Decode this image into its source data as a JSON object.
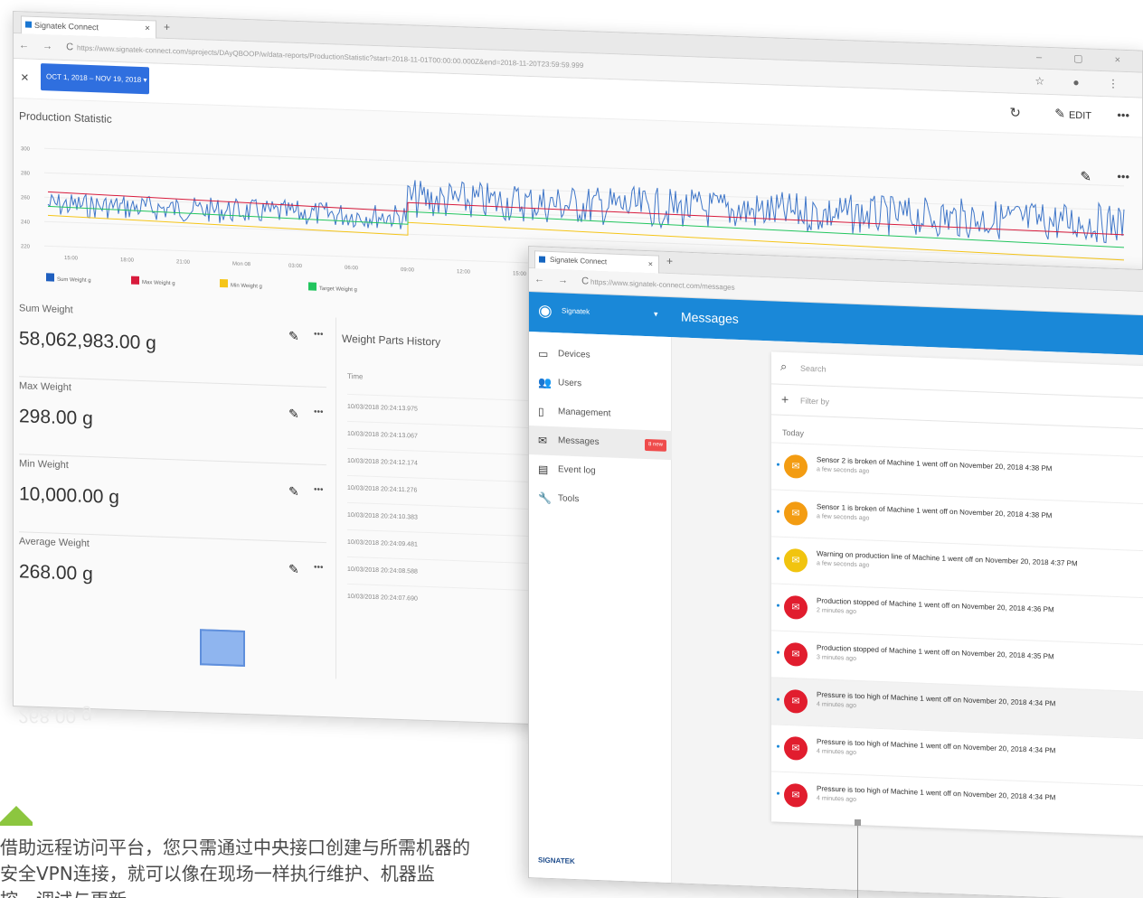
{
  "back_window": {
    "tab_title": "Signatek Connect",
    "url": "https://www.signatek-connect.com/sprojects/DAyQBOOP/w/data-reports/ProductionStatistic?start=2018-11-01T00:00:00.000Z&end=2018-11-20T23:59:59.999",
    "date_range": "OCT 1, 2018 – NOV 19, 2018 ▾",
    "edit_label": "EDIT",
    "chart_title": "Production Statistic",
    "chart_data": {
      "type": "line",
      "y_ticks": [
        "300",
        "280",
        "260",
        "240",
        "220"
      ],
      "x_ticks": [
        "15:00",
        "18:00",
        "21:00",
        "Mon 08",
        "03:00",
        "06:00",
        "09:00",
        "12:00",
        "15:00"
      ],
      "legend": [
        "Sum Weight g",
        "Max Weight g",
        "Min Weight g",
        "Target Weight g"
      ],
      "colors": [
        "#1f5fbf",
        "#d81b3c",
        "#f5c518",
        "#22c55e"
      ]
    },
    "stats": [
      {
        "label": "Sum Weight",
        "value": "58,062,983.00 g"
      },
      {
        "label": "Max Weight",
        "value": "298.00 g"
      },
      {
        "label": "Min Weight",
        "value": "10,000.00 g"
      },
      {
        "label": "Average Weight",
        "value": "268.00 g"
      }
    ],
    "history": {
      "title": "Weight Parts History",
      "column": "Time",
      "rows": [
        "10/03/2018 20:24:13.975",
        "10/03/2018 20:24:13.067",
        "10/03/2018 20:24:12.174",
        "10/03/2018 20:24:11.276",
        "10/03/2018 20:24:10.383",
        "10/03/2018 20:24:09.481",
        "10/03/2018 20:24:08.588",
        "10/03/2018 20:24:07.690"
      ]
    },
    "reflection_text": "268.00 g"
  },
  "front_window": {
    "tab_title": "Signatek Connect",
    "url": "https://www.signatek-connect.com/messages",
    "account": "Signatek",
    "header_title": "Messages",
    "sidebar": [
      {
        "label": "Devices",
        "icon": "devices-icon",
        "glyph": "▭"
      },
      {
        "label": "Users",
        "icon": "users-icon",
        "glyph": "👥"
      },
      {
        "label": "Management",
        "icon": "management-icon",
        "glyph": "▯"
      },
      {
        "label": "Messages",
        "icon": "messages-icon",
        "glyph": "✉",
        "badge": "8 new"
      },
      {
        "label": "Event log",
        "icon": "event-log-icon",
        "glyph": "▤"
      },
      {
        "label": "Tools",
        "icon": "tools-icon",
        "glyph": "🔧"
      }
    ],
    "logo": "SIGNATEK",
    "search_placeholder": "Search",
    "filter_placeholder": "Filter by",
    "group_label": "Today",
    "messages": [
      {
        "text": "Sensor 2 is broken of Machine 1 went off on November 20, 2018 4:38 PM",
        "ago": "a few seconds ago",
        "color": "orange"
      },
      {
        "text": "Sensor 1 is broken of Machine 1 went off on November 20, 2018 4:38 PM",
        "ago": "a few seconds ago",
        "color": "orange"
      },
      {
        "text": "Warning on production line of Machine 1 went off on November 20, 2018 4:37 PM",
        "ago": "a few seconds ago",
        "color": "yellow"
      },
      {
        "text": "Production stopped of Machine 1 went off on November 20, 2018 4:36 PM",
        "ago": "2 minutes ago",
        "color": "red"
      },
      {
        "text": "Production stopped of Machine 1 went off on November 20, 2018 4:35 PM",
        "ago": "3 minutes ago",
        "color": "red"
      },
      {
        "text": "Pressure is too high of Machine 1 went off on November 20, 2018 4:34 PM",
        "ago": "4 minutes ago",
        "color": "red"
      },
      {
        "text": "Pressure is too high of Machine 1 went off on November 20, 2018 4:34 PM",
        "ago": "4 minutes ago",
        "color": "red"
      },
      {
        "text": "Pressure is too high of Machine 1 went off on November 20, 2018 4:34 PM",
        "ago": "4 minutes ago",
        "color": "red"
      }
    ]
  },
  "caption": "借助远程访问平台，您只需通过中央接口创建与所需机器的安全VPN连接，就可以像在现场一样执行维护、机器监控、调试与更新。"
}
